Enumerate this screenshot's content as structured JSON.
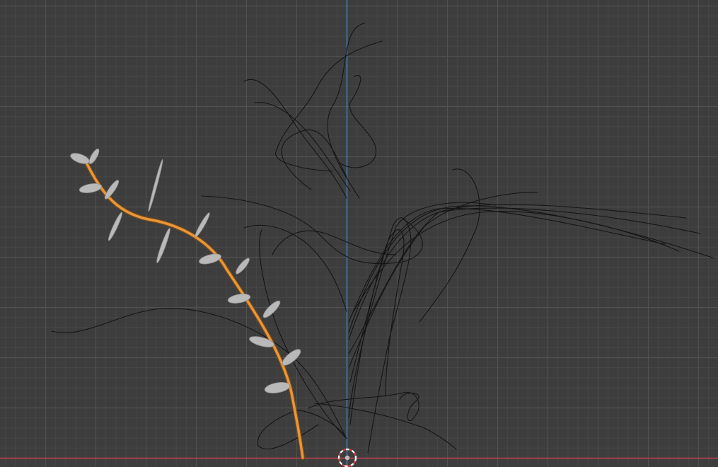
{
  "viewport": {
    "background_color": "#3d3d3d",
    "grid_minor_color": "#474747",
    "grid_major_color": "#515151",
    "axis_y_color": "#4c8fd6",
    "axis_x_color": "#c24151",
    "selected_curve_color": "#e8973a",
    "unselected_curve_color": "#151515",
    "leaf_color": "#b9b9b9",
    "origin_cursor_color": "#ffffff"
  },
  "scene": {
    "selected_object": "orange-curve-with-leaves",
    "objects": [
      "orange-curve-with-leaves",
      "black-hair-curves",
      "3d-cursor"
    ]
  },
  "icons": {
    "cursor": "3d-cursor-icon",
    "leaf": "leaf-icon"
  }
}
